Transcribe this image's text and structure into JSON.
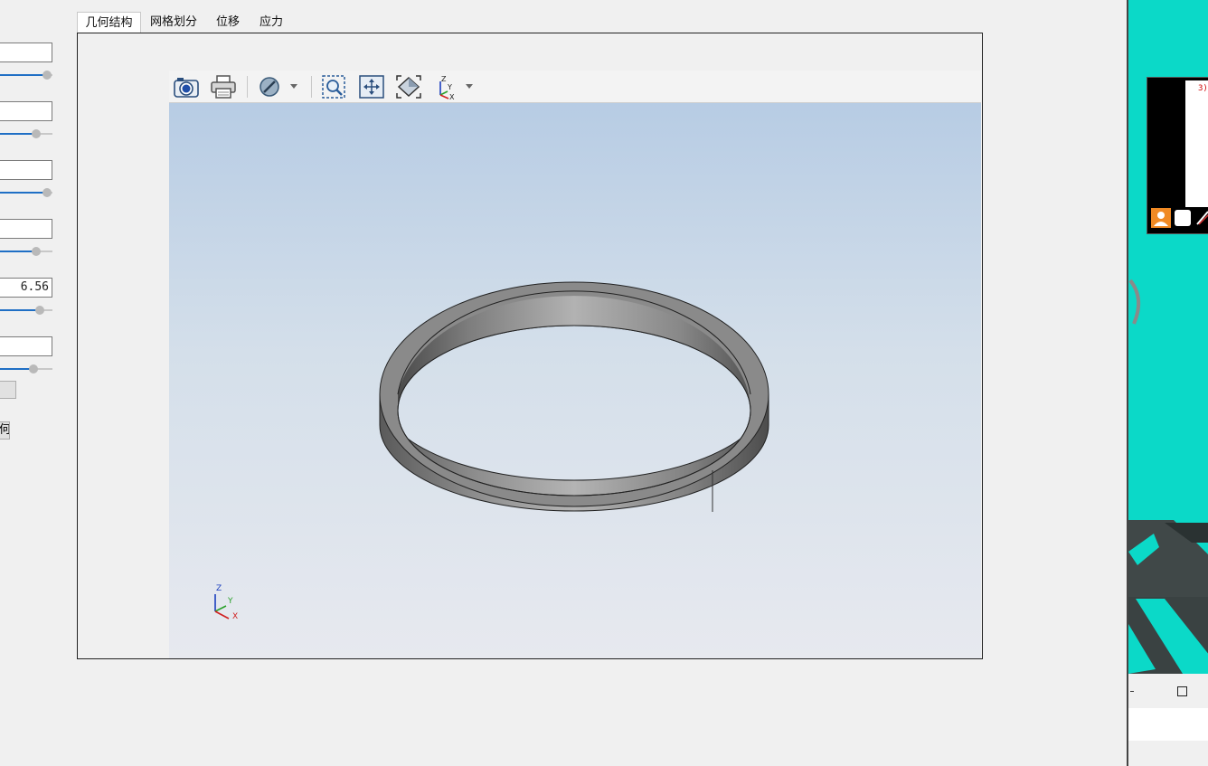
{
  "tabs": [
    {
      "label": "几何结构",
      "active": true
    },
    {
      "label": "网格划分",
      "active": false
    },
    {
      "label": "位移",
      "active": false
    },
    {
      "label": "应力",
      "active": false
    }
  ],
  "left_panel": {
    "fields": [
      {
        "value": ""
      },
      {
        "value": ""
      },
      {
        "value": ""
      },
      {
        "value": ""
      },
      {
        "value": "6.56"
      },
      {
        "value": ""
      }
    ],
    "sliders": [
      {
        "level": 0.93
      },
      {
        "level": 0.7
      },
      {
        "level": 0.93
      },
      {
        "level": 0.7
      },
      {
        "level": 0.79
      },
      {
        "level": 0.66
      }
    ],
    "buttons": [
      {
        "label": ""
      },
      {
        "label": "何"
      }
    ]
  },
  "viewer": {
    "toolbar": [
      {
        "icon": "camera-icon"
      },
      {
        "icon": "printer-icon"
      },
      {
        "icon": "display-mode-icon"
      },
      {
        "icon": "zoom-window-icon"
      },
      {
        "icon": "pan-icon"
      },
      {
        "icon": "fit-all-icon"
      },
      {
        "icon": "axes-view-icon"
      }
    ],
    "axis_labels": {
      "z": "Z",
      "y": "Y",
      "x": "X"
    },
    "background_top": "#b7cce4",
    "background_bottom": "#e7e9ef"
  },
  "right_window": {
    "thumbnail_text": "3)",
    "accent": "#0bd9c8"
  }
}
